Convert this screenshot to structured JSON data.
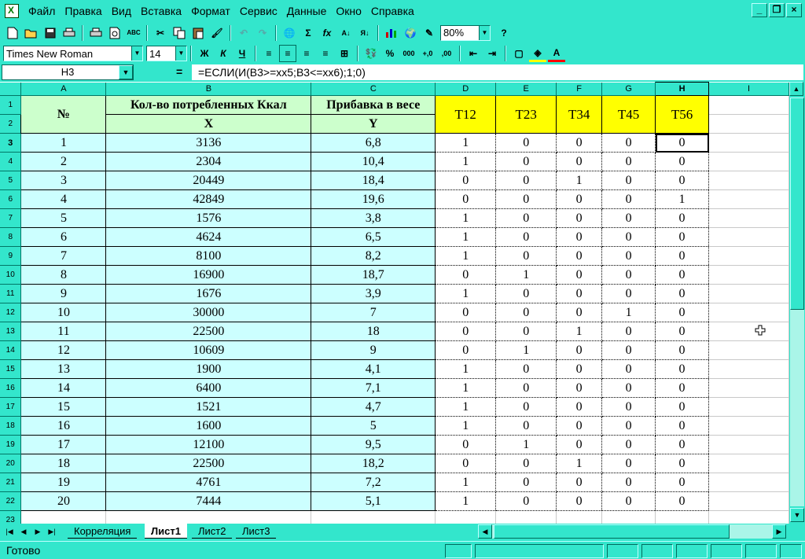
{
  "menu": [
    "Файл",
    "Правка",
    "Вид",
    "Вставка",
    "Формат",
    "Сервис",
    "Данные",
    "Окно",
    "Справка"
  ],
  "toolbar": {
    "zoom": "80%",
    "font_name": "Times New Roman",
    "font_size": "14",
    "bold": "Ж",
    "italic": "К",
    "underline": "Ч",
    "percent": "%",
    "thousands": "000",
    "sigma": "Σ",
    "fx": "fx"
  },
  "formula_bar": {
    "name_box": "H3",
    "eq": "=",
    "formula": "=ЕСЛИ(И(B3>=хх5;B3<=хх6);1;0)"
  },
  "columns": [
    "A",
    "B",
    "C",
    "D",
    "E",
    "F",
    "G",
    "H",
    "I"
  ],
  "active_column": "H",
  "header": {
    "no": "№",
    "kcal": "Кол-во потребленных Ккал",
    "weight": "Прибавка в весе",
    "x": "X",
    "y": "Y",
    "t": [
      "T12",
      "T23",
      "T34",
      "T45",
      "T56"
    ]
  },
  "rows": [
    {
      "n": "1",
      "x": "3136",
      "y": "6,8",
      "t": [
        "1",
        "0",
        "0",
        "0",
        "0"
      ]
    },
    {
      "n": "2",
      "x": "2304",
      "y": "10,4",
      "t": [
        "1",
        "0",
        "0",
        "0",
        "0"
      ]
    },
    {
      "n": "3",
      "x": "20449",
      "y": "18,4",
      "t": [
        "0",
        "0",
        "1",
        "0",
        "0"
      ]
    },
    {
      "n": "4",
      "x": "42849",
      "y": "19,6",
      "t": [
        "0",
        "0",
        "0",
        "0",
        "1"
      ]
    },
    {
      "n": "5",
      "x": "1576",
      "y": "3,8",
      "t": [
        "1",
        "0",
        "0",
        "0",
        "0"
      ]
    },
    {
      "n": "6",
      "x": "4624",
      "y": "6,5",
      "t": [
        "1",
        "0",
        "0",
        "0",
        "0"
      ]
    },
    {
      "n": "7",
      "x": "8100",
      "y": "8,2",
      "t": [
        "1",
        "0",
        "0",
        "0",
        "0"
      ]
    },
    {
      "n": "8",
      "x": "16900",
      "y": "18,7",
      "t": [
        "0",
        "1",
        "0",
        "0",
        "0"
      ]
    },
    {
      "n": "9",
      "x": "1676",
      "y": "3,9",
      "t": [
        "1",
        "0",
        "0",
        "0",
        "0"
      ]
    },
    {
      "n": "10",
      "x": "30000",
      "y": "7",
      "t": [
        "0",
        "0",
        "0",
        "1",
        "0"
      ]
    },
    {
      "n": "11",
      "x": "22500",
      "y": "18",
      "t": [
        "0",
        "0",
        "1",
        "0",
        "0"
      ]
    },
    {
      "n": "12",
      "x": "10609",
      "y": "9",
      "t": [
        "0",
        "1",
        "0",
        "0",
        "0"
      ]
    },
    {
      "n": "13",
      "x": "1900",
      "y": "4,1",
      "t": [
        "1",
        "0",
        "0",
        "0",
        "0"
      ]
    },
    {
      "n": "14",
      "x": "6400",
      "y": "7,1",
      "t": [
        "1",
        "0",
        "0",
        "0",
        "0"
      ]
    },
    {
      "n": "15",
      "x": "1521",
      "y": "4,7",
      "t": [
        "1",
        "0",
        "0",
        "0",
        "0"
      ]
    },
    {
      "n": "16",
      "x": "1600",
      "y": "5",
      "t": [
        "1",
        "0",
        "0",
        "0",
        "0"
      ]
    },
    {
      "n": "17",
      "x": "12100",
      "y": "9,5",
      "t": [
        "0",
        "1",
        "0",
        "0",
        "0"
      ]
    },
    {
      "n": "18",
      "x": "22500",
      "y": "18,2",
      "t": [
        "0",
        "0",
        "1",
        "0",
        "0"
      ]
    },
    {
      "n": "19",
      "x": "4761",
      "y": "7,2",
      "t": [
        "1",
        "0",
        "0",
        "0",
        "0"
      ]
    },
    {
      "n": "20",
      "x": "7444",
      "y": "5,1",
      "t": [
        "1",
        "0",
        "0",
        "0",
        "0"
      ]
    }
  ],
  "row_numbers": [
    "1",
    "2",
    "3",
    "4",
    "5",
    "6",
    "7",
    "8",
    "9",
    "10",
    "11",
    "12",
    "13",
    "14",
    "15",
    "16",
    "17",
    "18",
    "19",
    "20",
    "21",
    "22",
    "23"
  ],
  "sheet_tabs": [
    "Корреляция",
    "Лист1",
    "Лист2",
    "Лист3"
  ],
  "active_sheet": "Лист1",
  "status": "Готово",
  "colors": {
    "chrome": "#33e6cc",
    "data_fill": "#ccffff",
    "header_green": "#ccffcc",
    "header_yellow": "#ffff00"
  }
}
